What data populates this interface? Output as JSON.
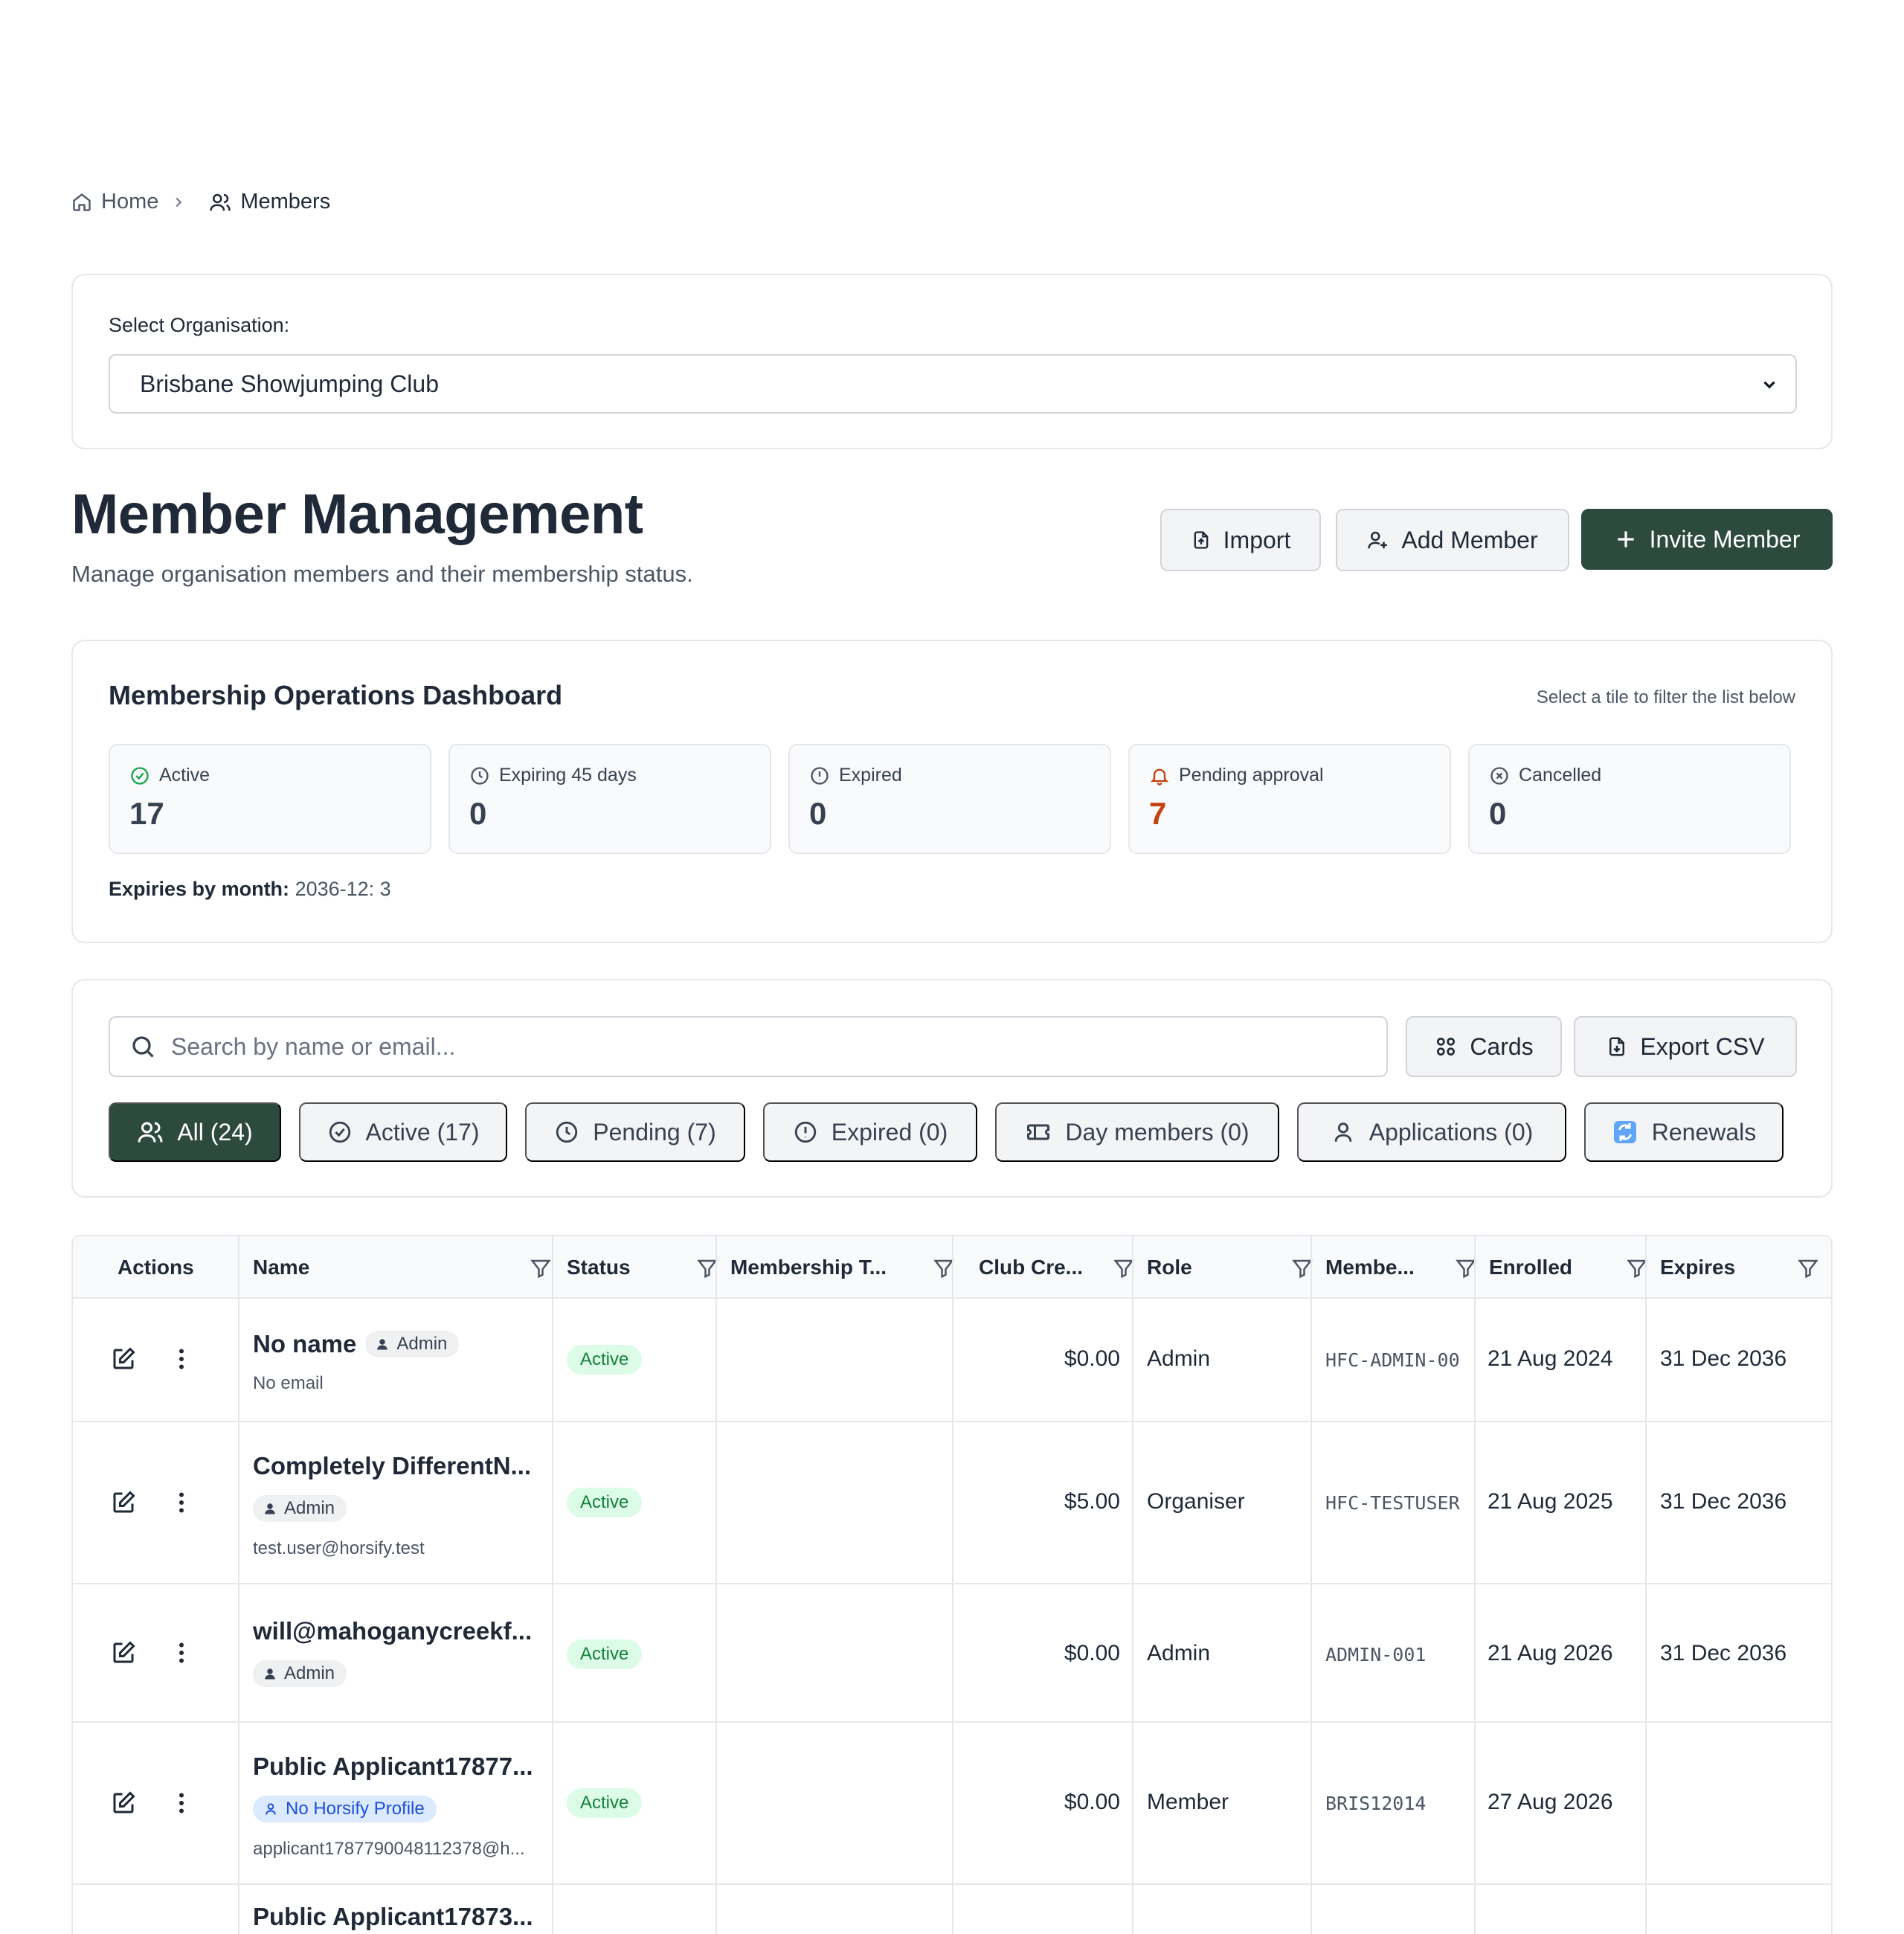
{
  "breadcrumb": {
    "home": "Home",
    "current": "Members"
  },
  "org": {
    "label": "Select Organisation:",
    "selected": "Brisbane Showjumping Club"
  },
  "header": {
    "title": "Member Management",
    "subtitle": "Manage organisation members and their membership status.",
    "import_label": "Import",
    "add_label": "Add Member",
    "invite_label": "Invite Member"
  },
  "dashboard": {
    "title": "Membership Operations Dashboard",
    "hint": "Select a tile to filter the list below",
    "tiles": [
      {
        "label": "Active",
        "value": "17",
        "icon": "check-circle-icon"
      },
      {
        "label": "Expiring 45 days",
        "value": "0",
        "icon": "clock-icon"
      },
      {
        "label": "Expired",
        "value": "0",
        "icon": "alert-circle-icon"
      },
      {
        "label": "Pending approval",
        "value": "7",
        "icon": "bell-icon"
      },
      {
        "label": "Cancelled",
        "value": "0",
        "icon": "x-circle-icon"
      }
    ],
    "expiries_label": "Expiries by month:",
    "expiries_value": "2036-12: 3"
  },
  "filters": {
    "search_placeholder": "Search by name or email...",
    "cards_label": "Cards",
    "export_label": "Export CSV",
    "pills": [
      {
        "label": "All (24)",
        "icon": "users-icon"
      },
      {
        "label": "Active (17)",
        "icon": "check-circle-icon"
      },
      {
        "label": "Pending (7)",
        "icon": "clock-icon"
      },
      {
        "label": "Expired (0)",
        "icon": "alert-circle-icon"
      },
      {
        "label": "Day members (0)",
        "icon": "ticket-icon"
      },
      {
        "label": "Applications (0)",
        "icon": "user-icon"
      },
      {
        "label": "Renewals",
        "icon": "refresh-icon"
      }
    ]
  },
  "table": {
    "columns": [
      "Actions",
      "Name",
      "Status",
      "Membership T...",
      "Club Cre...",
      "Role",
      "Membe...",
      "Enrolled",
      "Expires"
    ],
    "rows": [
      {
        "name": "No name",
        "badge": "Admin",
        "email": "No email",
        "status": "Active",
        "membership_type": "",
        "credit": "$0.00",
        "role": "Admin",
        "member_no": "HFC-ADMIN-00",
        "enrolled": "21 Aug 2024",
        "expires": "31 Dec 2036"
      },
      {
        "name": "Completely DifferentN...",
        "badge": "Admin",
        "email": "test.user@horsify.test",
        "status": "Active",
        "membership_type": "",
        "credit": "$5.00",
        "role": "Organiser",
        "member_no": "HFC-TESTUSER",
        "enrolled": "21 Aug 2025",
        "expires": "31 Dec 2036"
      },
      {
        "name": "will@mahoganycreekf...",
        "badge": "Admin",
        "email": "",
        "status": "Active",
        "membership_type": "",
        "credit": "$0.00",
        "role": "Admin",
        "member_no": "ADMIN-001",
        "enrolled": "21 Aug 2026",
        "expires": "31 Dec 2036"
      },
      {
        "name": "Public Applicant17877...",
        "badge": "No Horsify Profile",
        "email": "applicant1787790048112378@h...",
        "status": "Active",
        "membership_type": "",
        "credit": "$0.00",
        "role": "Member",
        "member_no": "BRIS12014",
        "enrolled": "27 Aug 2026",
        "expires": ""
      },
      {
        "name": "Public Applicant17873..."
      }
    ]
  },
  "colors": {
    "brand": "#2d4a3e",
    "pending_accent": "#c2410c",
    "active_badge": "#dcfce7",
    "profile_badge": "#dbeafe"
  }
}
